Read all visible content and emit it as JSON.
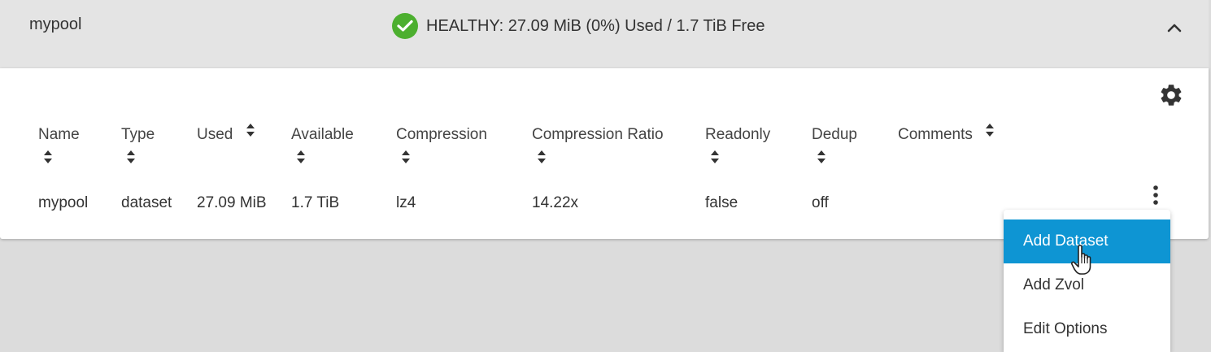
{
  "pool": {
    "name": "mypool",
    "status_text": "HEALTHY: 27.09 MiB (0%) Used / 1.7 TiB Free",
    "status_color": "#4caf2f"
  },
  "table": {
    "columns": [
      "Name",
      "Type",
      "Used",
      "Available",
      "Compression",
      "Compression Ratio",
      "Readonly",
      "Dedup",
      "Comments"
    ],
    "rows": [
      [
        "mypool",
        "dataset",
        "27.09 MiB",
        "1.7 TiB",
        "lz4",
        "14.22x",
        "false",
        "off",
        ""
      ]
    ]
  },
  "menu": {
    "items": [
      "Add Dataset",
      "Add Zvol",
      "Edit Options"
    ],
    "active_index": 0,
    "accent": "#0e95d3"
  },
  "icons": {
    "status": "check-circle-icon",
    "collapse": "chevron-up-icon",
    "settings": "gear-icon",
    "actions": "more-vert-icon",
    "sort": "sort-icon",
    "pointer": "hand-pointer-icon"
  }
}
